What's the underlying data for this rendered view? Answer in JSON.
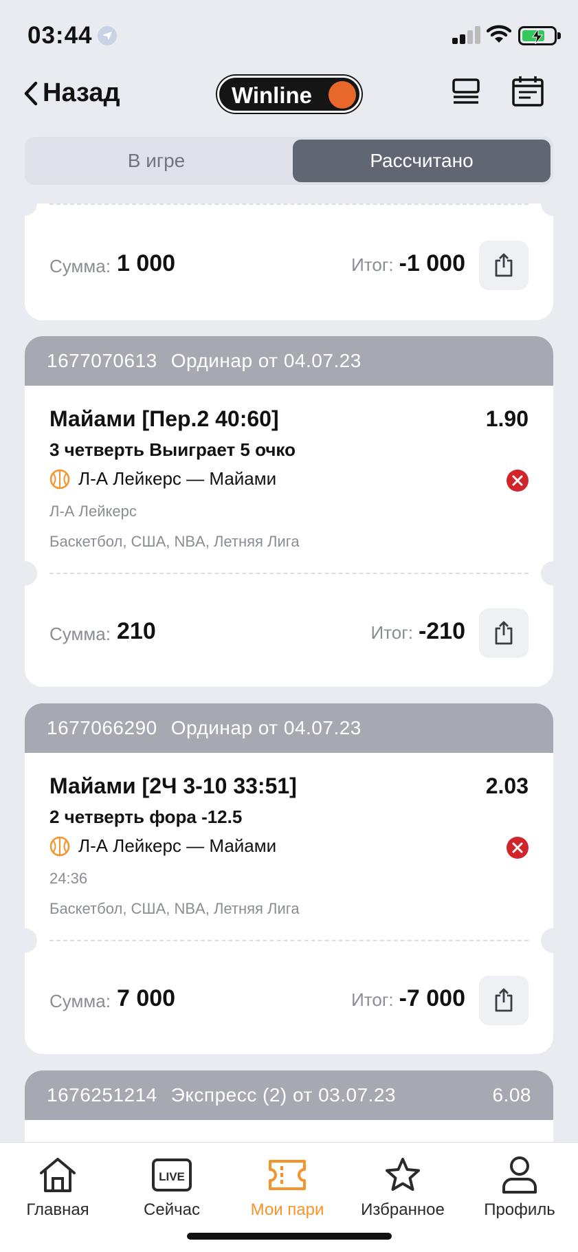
{
  "status_bar": {
    "time": "03:44"
  },
  "header": {
    "back_label": "Назад",
    "logo_text": "Winline"
  },
  "segmented": {
    "tab_in_game": "В игре",
    "tab_settled": "Рассчитано",
    "active": "tab_settled"
  },
  "cards": {
    "partial": {
      "sum_label": "Сумма:",
      "sum_value": "1 000",
      "result_label": "Итог:",
      "result_value": "-1 000"
    },
    "bet1": {
      "bet_id": "1677070613",
      "type": "Ординар от 04.07.23",
      "title": "Майами [Пер.2 40:60]",
      "odds": "1.90",
      "market": "3 четверть Выиграет 5 очко",
      "match": "Л-А Лейкерс — Майами",
      "detail1": "Л-А Лейкерс",
      "detail2": "Баскетбол, США, NBA, Летняя Лига",
      "status": "lost",
      "sum_label": "Сумма:",
      "sum_value": "210",
      "result_label": "Итог:",
      "result_value": "-210"
    },
    "bet2": {
      "bet_id": "1677066290",
      "type": "Ординар от 04.07.23",
      "title": "Майами [2Ч 3-10 33:51]",
      "odds": "2.03",
      "market": "2 четверть фора -12.5",
      "match": "Л-А Лейкерс — Майами",
      "detail1": "24:36",
      "detail2": "Баскетбол, США, NBA, Летняя Лига",
      "status": "lost",
      "sum_label": "Сумма:",
      "sum_value": "7 000",
      "result_label": "Итог:",
      "result_value": "-7 000"
    },
    "bet3": {
      "bet_id": "1676251214",
      "type": "Экспресс (2) от 03.07.23",
      "total_odds": "6.08"
    }
  },
  "tabbar": {
    "items": [
      {
        "label": "Главная",
        "icon": "home-icon"
      },
      {
        "label": "Сейчас",
        "icon": "live-icon",
        "badge": "LIVE"
      },
      {
        "label": "Мои пари",
        "icon": "ticket-icon",
        "active": true
      },
      {
        "label": "Избранное",
        "icon": "star-icon"
      },
      {
        "label": "Профиль",
        "icon": "profile-icon"
      }
    ]
  },
  "colors": {
    "accent": "#f7932b",
    "lost": "#d0262b",
    "header_gray": "#a6a9b1",
    "segment_active": "#616673",
    "logo_dot": "#e8682c"
  }
}
